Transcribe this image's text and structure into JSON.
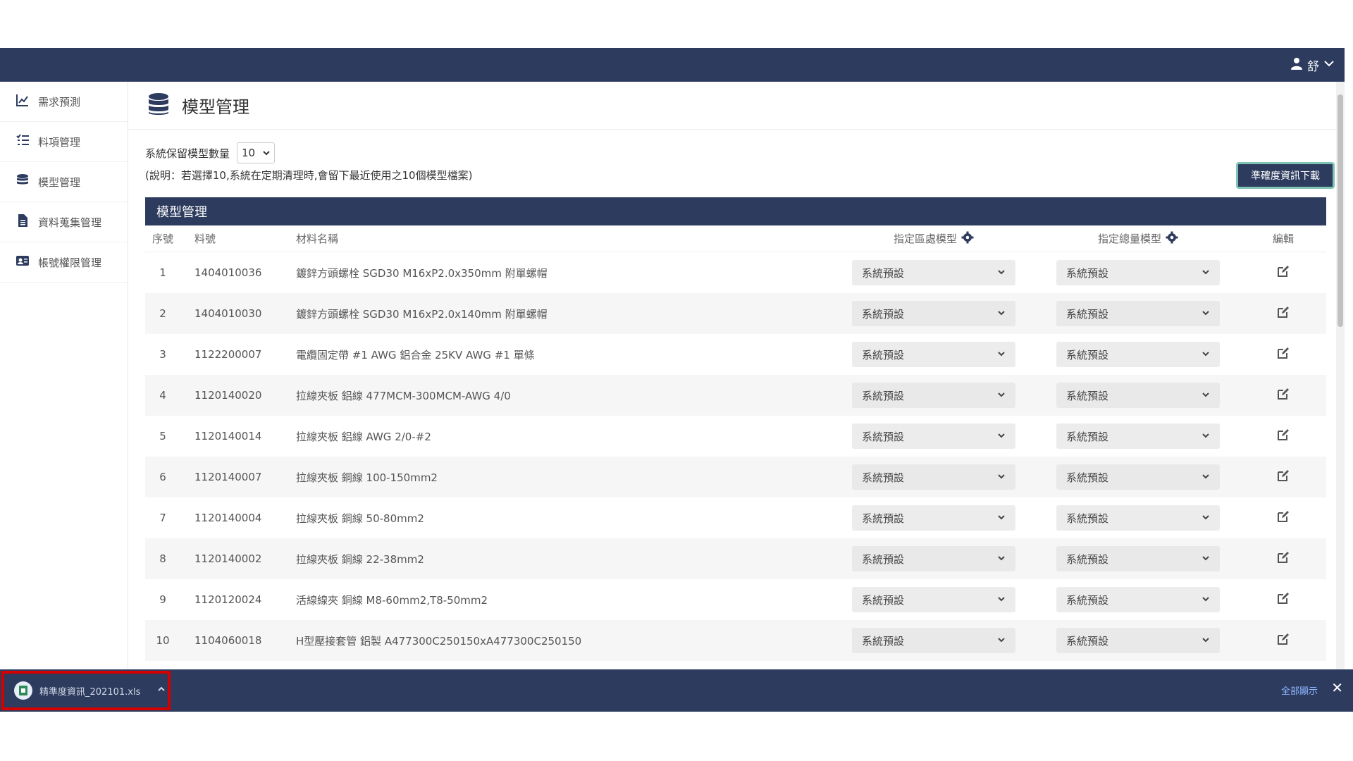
{
  "header": {
    "user_name": "舒"
  },
  "sidebar": {
    "items": [
      {
        "label": "需求預測",
        "icon": "chart-line-icon"
      },
      {
        "label": "料項管理",
        "icon": "list-check-icon"
      },
      {
        "label": "模型管理",
        "icon": "database-icon"
      },
      {
        "label": "資料蒐集管理",
        "icon": "file-icon"
      },
      {
        "label": "帳號權限管理",
        "icon": "id-card-icon"
      }
    ]
  },
  "page": {
    "title": "模型管理",
    "keep_label": "系統保留模型數量",
    "keep_value": "10",
    "note": "(說明：若選擇10,系統在定期清理時,會留下最近使用之10個模型檔案)",
    "download_button": "準確度資訊下載"
  },
  "table": {
    "title": "模型管理",
    "headers": {
      "no": "序號",
      "code": "料號",
      "name": "材料名稱",
      "region_model": "指定區處模型",
      "total_model": "指定總量模型",
      "edit": "編輯"
    },
    "rows": [
      {
        "no": "1",
        "code": "1404010036",
        "name": "鍍鋅方頭螺栓 SGD30 M16xP2.0x350mm 附單螺帽",
        "region": "系統預設",
        "total": "系統預設"
      },
      {
        "no": "2",
        "code": "1404010030",
        "name": "鍍鋅方頭螺栓 SGD30 M16xP2.0x140mm 附單螺帽",
        "region": "系統預設",
        "total": "系統預設"
      },
      {
        "no": "3",
        "code": "1122200007",
        "name": "電纜固定帶 #1 AWG 鋁合金 25KV AWG #1 單條",
        "region": "系統預設",
        "total": "系統預設"
      },
      {
        "no": "4",
        "code": "1120140020",
        "name": "拉線夾板 鋁線 477MCM-300MCM-AWG 4/0",
        "region": "系統預設",
        "total": "系統預設"
      },
      {
        "no": "5",
        "code": "1120140014",
        "name": "拉線夾板 鋁線 AWG 2/0-#2",
        "region": "系統預設",
        "total": "系統預設"
      },
      {
        "no": "6",
        "code": "1120140007",
        "name": "拉線夾板 銅線 100-150mm2",
        "region": "系統預設",
        "total": "系統預設"
      },
      {
        "no": "7",
        "code": "1120140004",
        "name": "拉線夾板 銅線 50-80mm2",
        "region": "系統預設",
        "total": "系統預設"
      },
      {
        "no": "8",
        "code": "1120140002",
        "name": "拉線夾板 銅線 22-38mm2",
        "region": "系統預設",
        "total": "系統預設"
      },
      {
        "no": "9",
        "code": "1120120024",
        "name": "活線線夾 銅線 M8-60mm2,T8-50mm2",
        "region": "系統預設",
        "total": "系統預設"
      },
      {
        "no": "10",
        "code": "1104060018",
        "name": "H型壓接套管 鋁製 A477300C250150xA477300C250150",
        "region": "系統預設",
        "total": "系統預設"
      }
    ]
  },
  "download_bar": {
    "filename": "精準度資訊_202101.xls",
    "show_all": "全部顯示",
    "close": "✕"
  }
}
